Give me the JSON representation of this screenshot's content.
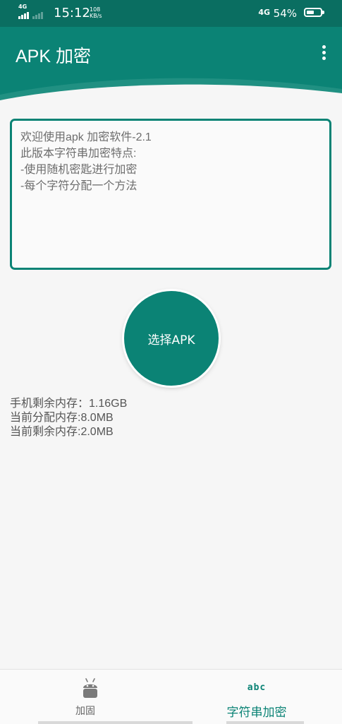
{
  "status_bar": {
    "network_left": "4G",
    "time": "15:12",
    "speed_value": "108",
    "speed_unit": "KB/s",
    "network_right": "4G",
    "battery_percent": "54%",
    "battery_level": 0.54
  },
  "app_bar": {
    "title": "APK 加密",
    "menu_icon": "overflow-vertical-icon"
  },
  "description": {
    "lines": [
      "欢迎使用apk 加密软件-2.1",
      "此版本字符串加密特点:",
      "-使用随机密匙进行加密",
      "-每个字符分配一个方法"
    ]
  },
  "select_button": {
    "label": "选择APK"
  },
  "memory": {
    "lines": [
      "手机剩余内存：1.16GB",
      "当前分配内存:8.0MB",
      "当前剩余内存:2.0MB"
    ]
  },
  "bottom_nav": {
    "items": [
      {
        "label": "加固",
        "icon": "android-icon"
      },
      {
        "label": "字符串加密",
        "icon": "abc-icon",
        "icon_text": "abc"
      }
    ]
  },
  "colors": {
    "primary": "#0b8375",
    "primary_dark": "#0a6e61",
    "background": "#f6f6f6"
  }
}
